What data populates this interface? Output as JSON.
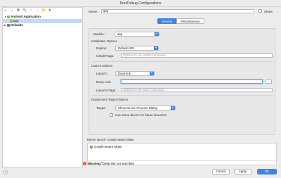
{
  "window": {
    "title": "Run/Debug Configurations"
  },
  "sidebar": {
    "toolbar": [
      "+",
      "−",
      "⧉",
      "🔧",
      "↑",
      "↓",
      "📁",
      "⇅"
    ],
    "tree": [
      {
        "label": "Android Application",
        "expanded": true,
        "level": 0,
        "icon": "android-icon"
      },
      {
        "label": "app",
        "level": 1,
        "selected": true,
        "icon": "android-icon"
      },
      {
        "label": "Defaults",
        "expanded": false,
        "level": 0,
        "icon": "defaults-icon"
      }
    ]
  },
  "main": {
    "name_label": "Name:",
    "name_value": "app",
    "share_label": "Share",
    "tabs": [
      {
        "label": "General",
        "active": true
      },
      {
        "label": "Miscellaneous",
        "active": false
      }
    ],
    "module_label": "Module:",
    "module_value": "app",
    "installation": {
      "title": "Installation Options",
      "deploy_label": "Deploy:",
      "deploy_value": "Default APK",
      "install_flags_label": "Install Flags:",
      "install_flags_placeholder": "Options to 'pm install' command"
    },
    "launch": {
      "title": "Launch Options",
      "launch_label": "Launch:",
      "launch_value": "Deep link",
      "deep_link_label": "Deep Link:",
      "deep_link_value": "",
      "launch_flags_label": "Launch Flags:",
      "launch_flags_placeholder": "Options to 'am start' command"
    },
    "deployment": {
      "title": "Deployment Target Options",
      "target_label": "Target:",
      "target_value": "Show Device Chooser Dialog",
      "use_same_device_label": "Use same device for future launches"
    },
    "before_launch": {
      "title": "Before launch: Gradle-aware Make",
      "items": [
        "Gradle-aware Make"
      ],
      "tools": [
        "+",
        "−",
        "✎",
        "↑",
        "↓"
      ]
    },
    "warning": {
      "label": "Warning:",
      "text": "Deep link not specified"
    }
  },
  "buttons": {
    "help": "?",
    "cancel": "Cancel",
    "apply": "Apply",
    "ok": "OK"
  }
}
